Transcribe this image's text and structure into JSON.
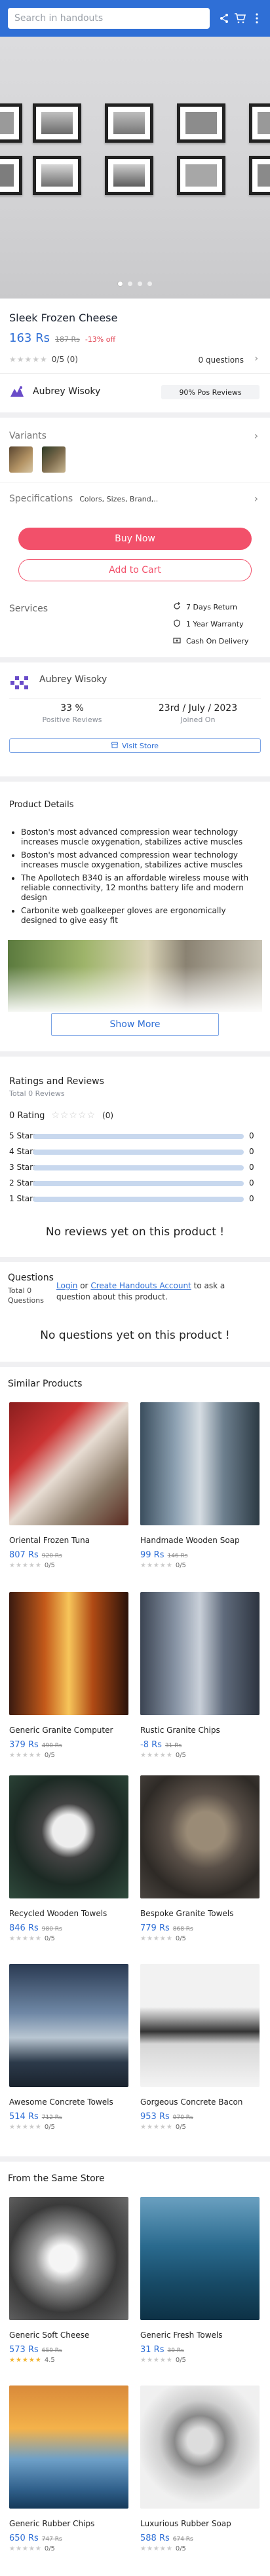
{
  "header": {
    "search_placeholder": "Search in handouts"
  },
  "product": {
    "title": "Sleek Frozen Cheese",
    "price": "163 Rs",
    "old_price": "187 Rs",
    "discount": "-13% off",
    "rating_text": "0/5 (0)",
    "questions_text": "0 questions"
  },
  "seller": {
    "name": "Aubrey Wisoky",
    "positive": "90% Pos Reviews",
    "positive_pct": "33 %",
    "positive_label": "Positive Reviews",
    "joined": "23rd / July / 2023",
    "joined_label": "Joined On",
    "visit": "Visit Store"
  },
  "variants_label": "Variants",
  "specs": {
    "label": "Specifications",
    "value": "Colors, Sizes, Brand,.."
  },
  "actions": {
    "buy": "Buy Now",
    "cart": "Add to Cart"
  },
  "services": {
    "label": "Services",
    "items": [
      "7 Days Return",
      "1 Year Warranty",
      "Cash On Delivery"
    ]
  },
  "details": {
    "title": "Product Details",
    "bullets": [
      "Boston's most advanced compression wear technology increases muscle oxygenation, stabilizes active muscles",
      "Boston's most advanced compression wear technology increases muscle oxygenation, stabilizes active muscles",
      "The Apollotech B340 is an affordable wireless mouse with reliable connectivity, 12 months battery life and modern design",
      "Carbonite web goalkeeper gloves are ergonomically designed to give easy fit"
    ],
    "show_more": "Show More"
  },
  "reviews": {
    "title": "Ratings and Reviews",
    "total": "Total 0 Reviews",
    "rating": "0 Rating",
    "count": "(0)",
    "rows": [
      {
        "label": "5 Stars",
        "count": "0"
      },
      {
        "label": "4 Stars",
        "count": "0"
      },
      {
        "label": "3 Stars",
        "count": "0"
      },
      {
        "label": "2 Stars",
        "count": "0"
      },
      {
        "label": "1 Stars",
        "count": "0"
      }
    ],
    "empty": "No reviews yet on this product !"
  },
  "questions": {
    "title": "Questions",
    "total": "Total 0 Questions",
    "login": "Login",
    "or": "or",
    "create": "Create Handouts Account",
    "ask": "to ask a question about this product.",
    "empty": "No questions yet on this product !"
  },
  "similar": {
    "title": "Similar Products",
    "items": [
      {
        "name": "Oriental Frozen Tuna",
        "price": "807 Rs",
        "old": "920 Rs",
        "rating": "0/5"
      },
      {
        "name": "Handmade Wooden Soap",
        "price": "99 Rs",
        "old": "146 Rs",
        "rating": "0/5"
      },
      {
        "name": "Generic Granite Computer",
        "price": "379 Rs",
        "old": "490 Rs",
        "rating": "0/5"
      },
      {
        "name": "Rustic Granite Chips",
        "price": "-8 Rs",
        "old": "31 Rs",
        "rating": "0/5"
      },
      {
        "name": "Recycled Wooden Towels",
        "price": "846 Rs",
        "old": "980 Rs",
        "rating": "0/5"
      },
      {
        "name": "Bespoke Granite Towels",
        "price": "779 Rs",
        "old": "868 Rs",
        "rating": "0/5"
      },
      {
        "name": "Awesome Concrete Towels",
        "price": "514 Rs",
        "old": "712 Rs",
        "rating": "0/5"
      },
      {
        "name": "Gorgeous Concrete Bacon",
        "price": "953 Rs",
        "old": "970 Rs",
        "rating": "0/5"
      }
    ]
  },
  "store": {
    "title": "From the Same Store",
    "items": [
      {
        "name": "Generic Soft Cheese",
        "price": "573 Rs",
        "old": "659 Rs",
        "rating": "4.5"
      },
      {
        "name": "Generic Fresh Towels",
        "price": "31 Rs",
        "old": "39 Rs",
        "rating": "0/5"
      },
      {
        "name": "Generic Rubber Chips",
        "price": "650 Rs",
        "old": "747 Rs",
        "rating": "0/5"
      },
      {
        "name": "Luxurious Rubber Soap",
        "price": "588 Rs",
        "old": "674 Rs",
        "rating": "0/5"
      }
    ]
  },
  "colors": {
    "brand": "#2f6fd6",
    "accent": "#f2506a"
  }
}
